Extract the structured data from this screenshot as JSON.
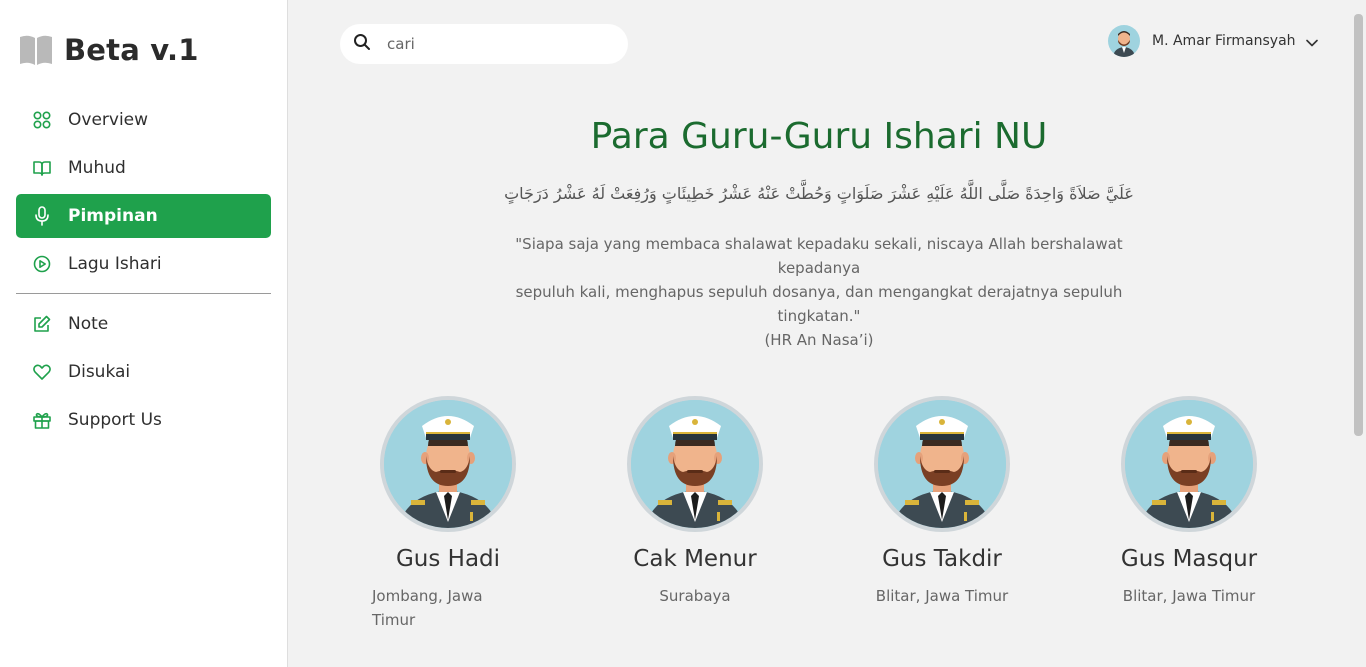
{
  "app": {
    "title": "Beta v.1"
  },
  "sidebar": {
    "items": [
      {
        "label": "Overview",
        "icon": "grid-icon"
      },
      {
        "label": "Muhud",
        "icon": "book-open-icon"
      },
      {
        "label": "Pimpinan",
        "icon": "microphone-icon",
        "active": true
      },
      {
        "label": "Lagu Ishari",
        "icon": "play-circle-icon"
      }
    ],
    "items2": [
      {
        "label": "Note",
        "icon": "edit-icon"
      },
      {
        "label": "Disukai",
        "icon": "heart-icon"
      },
      {
        "label": "Support Us",
        "icon": "gift-icon"
      }
    ]
  },
  "search": {
    "placeholder": "cari",
    "value": ""
  },
  "user": {
    "name": "M. Amar Firmansyah"
  },
  "main": {
    "heading": "Para Guru-Guru Ishari NU",
    "arabic": "عَلَيَّ صَلاَةً وَاحِدَةً صَلَّى اللَّهُ عَلَيْهِ عَشْرَ صَلَوَاتٍ وَحُطَّتْ عَنْهُ عَشْرُ خَطِيئَاتٍ وَرُفِعَتْ لَهُ عَشْرُ دَرَجَاتٍ",
    "quote_line1": "\"Siapa saja yang membaca shalawat kepadaku sekali, niscaya Allah bershalawat kepadanya",
    "quote_line2": "sepuluh kali, menghapus sepuluh dosanya, dan mengangkat derajatnya sepuluh tingkatan.\"",
    "quote_source": "(HR An Nasa’i)"
  },
  "teachers": [
    {
      "name": "Gus Hadi",
      "location": "Jombang, Jawa Timur"
    },
    {
      "name": "Cak Menur",
      "location": "Surabaya"
    },
    {
      "name": "Gus Takdir",
      "location": "Blitar, Jawa Timur"
    },
    {
      "name": "Gus Masqur",
      "location": "Blitar, Jawa Timur"
    }
  ],
  "colors": {
    "accent": "#1fa14c",
    "heading": "#1b6b2f",
    "icon": "#1fa14c"
  }
}
